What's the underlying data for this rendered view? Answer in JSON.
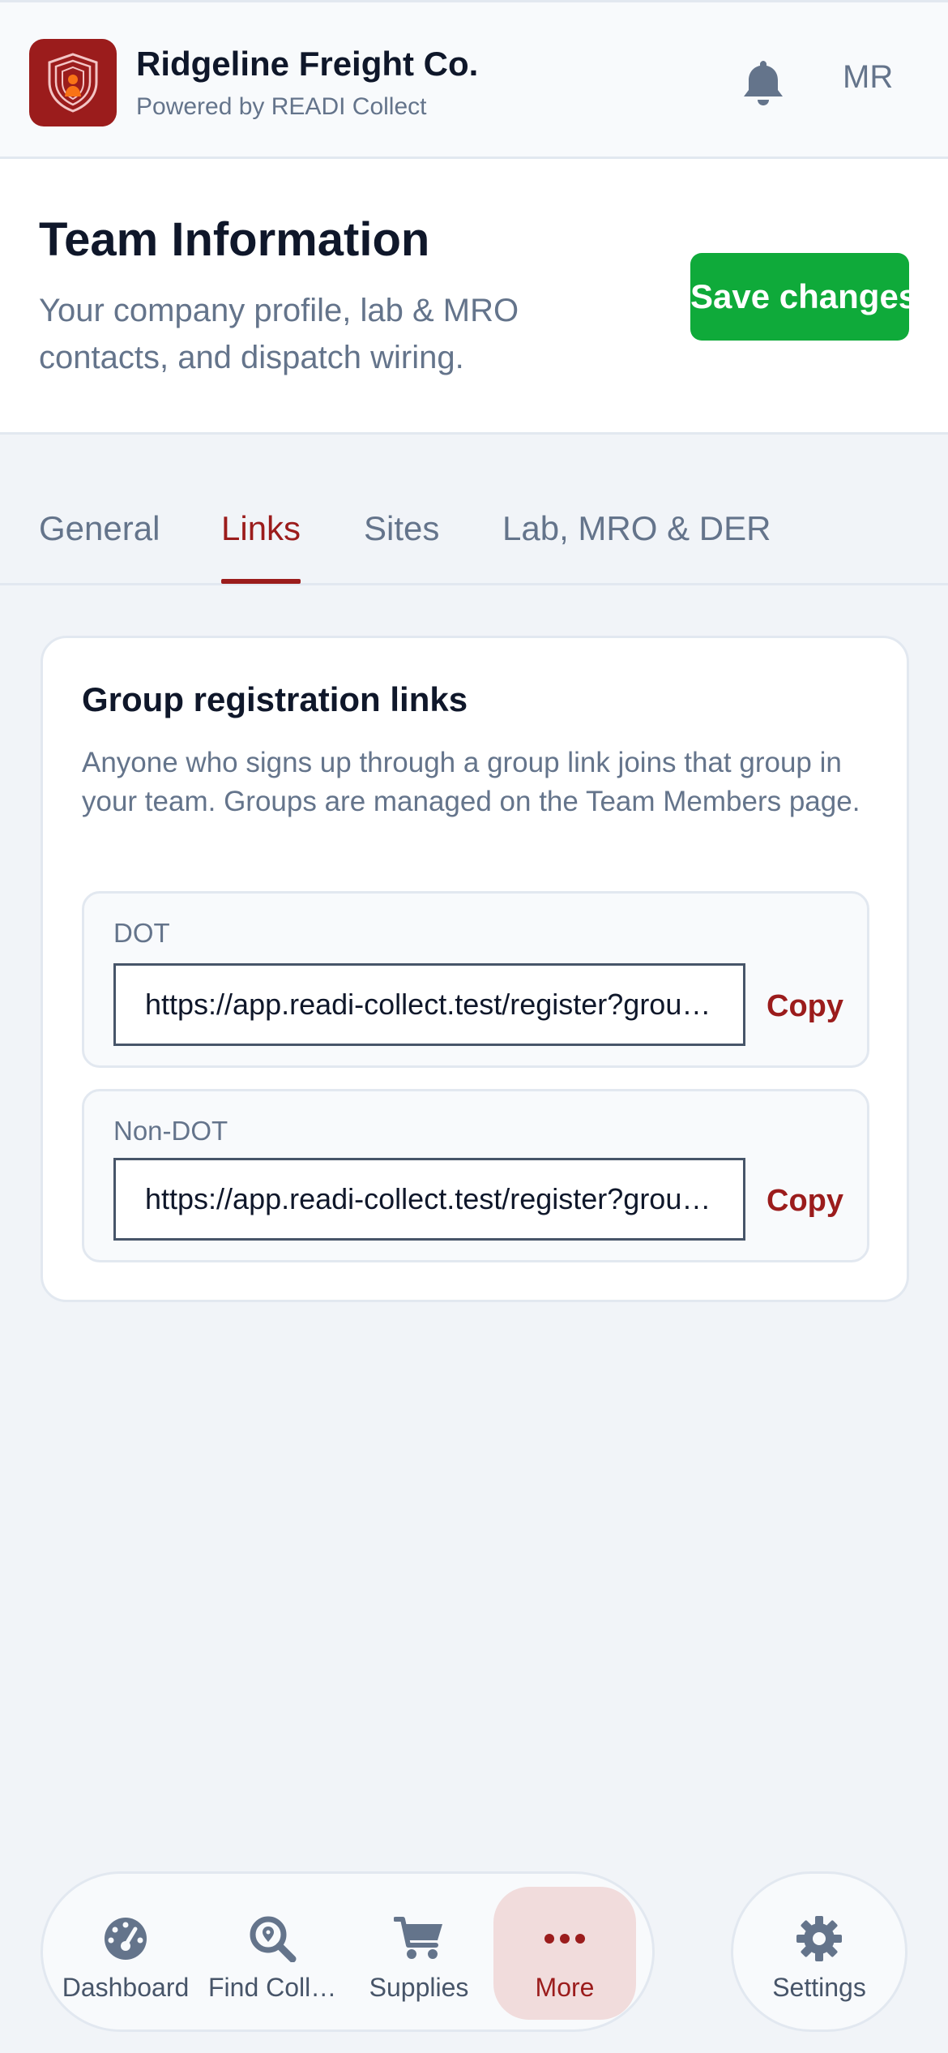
{
  "header": {
    "company_name": "Ridgeline Freight Co.",
    "powered_by": "Powered by READI Collect",
    "user_initials": "MR",
    "logo_icon": "shield-person-icon",
    "notification_icon": "bell-icon"
  },
  "page": {
    "title": "Team Information",
    "subtitle": "Your company profile, lab & MRO contacts, and dispatch wiring.",
    "save_label": "Save changes"
  },
  "tabs": [
    {
      "label": "General",
      "active": false
    },
    {
      "label": "Links",
      "active": true
    },
    {
      "label": "Sites",
      "active": false
    },
    {
      "label": "Lab, MRO & DER",
      "active": false
    }
  ],
  "group_links": {
    "title": "Group registration links",
    "description": "Anyone who signs up through a group link joins that group in your team. Groups are managed on the Team Members page.",
    "items": [
      {
        "label": "DOT",
        "url": "https://app.readi-collect.test/register?group=dot",
        "copy_label": "Copy"
      },
      {
        "label": "Non-DOT",
        "url": "https://app.readi-collect.test/register?group=non-dot",
        "copy_label": "Copy"
      }
    ]
  },
  "bottom_nav": {
    "items": [
      {
        "label": "Dashboard",
        "icon": "gauge-icon",
        "active": false
      },
      {
        "label": "Find Collector",
        "icon": "search-location-icon",
        "active": false
      },
      {
        "label": "Supplies",
        "icon": "cart-icon",
        "active": false
      },
      {
        "label": "More",
        "icon": "more-dots-icon",
        "active": true
      }
    ],
    "settings": {
      "label": "Settings",
      "icon": "gear-icon"
    }
  },
  "colors": {
    "brand": "#9b1c1c",
    "save_green": "#0faa3a",
    "background": "#f1f4f8",
    "muted_text": "#64748b"
  }
}
